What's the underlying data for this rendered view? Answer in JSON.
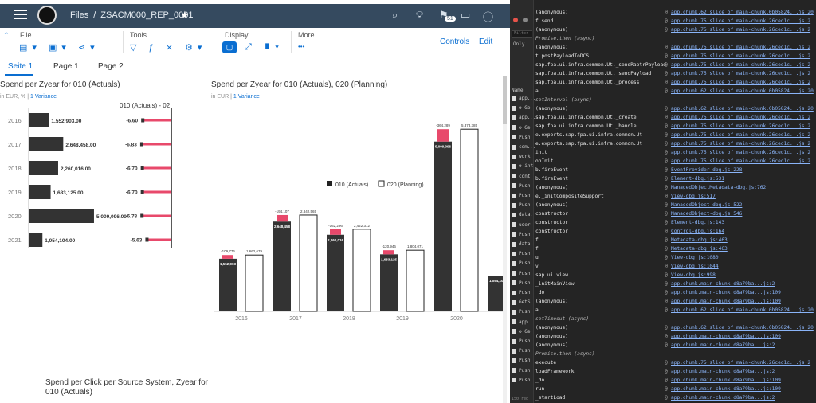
{
  "shell": {
    "breadcrumb_root": "Files",
    "breadcrumb_sep": "/",
    "story_title": "ZSACM000_REP_0001",
    "notifications_count": "51"
  },
  "toolbar": {
    "file_label": "File",
    "tools_label": "Tools",
    "display_label": "Display",
    "more_label": "More",
    "more_dots": "•••",
    "controls_label": "Controls",
    "edit_label": "Edit"
  },
  "tabs": [
    "Seite 1",
    "Page 1",
    "Page 2"
  ],
  "widgets": {
    "chart1": {
      "title": "Spend per Zyear for 010 (Actuals)",
      "unit": "in EUR, %",
      "variance": "1 Variance",
      "variance_header": "010 (Actuals) - 02"
    },
    "chart2": {
      "title": "Spend per Zyear for 010 (Actuals), 020 (Planning)",
      "unit": "in EUR",
      "variance": "1 Variance"
    },
    "chart3": {
      "title_line1": "Spend per Click per Source System, Zyear for",
      "title_line2": "010 (Actuals)"
    }
  },
  "chart_data": [
    {
      "type": "bar",
      "orientation": "horizontal",
      "title": "Spend per Zyear for 010 (Actuals)",
      "categories": [
        "2016",
        "2017",
        "2018",
        "2019",
        "2020",
        "2021"
      ],
      "series": [
        {
          "name": "010 (Actuals)",
          "values": [
            1552903,
            2648458,
            2260016,
            1683125,
            5009096,
            1054104
          ],
          "labels": [
            "1,552,903.00",
            "2,648,458.00",
            "2,260,016.00",
            "1,683,125.00",
            "5,009,096.00",
            "1,054,104.00"
          ]
        },
        {
          "name": "010 (Actuals) - 02",
          "values": [
            -6.6,
            -6.83,
            -6.7,
            -6.7,
            -6.78,
            -5.63
          ],
          "labels": [
            "-6.60",
            "-6.83",
            "-6.70",
            "-6.70",
            "-6.78",
            "-5.63"
          ]
        }
      ]
    },
    {
      "type": "bar",
      "title": "Spend per Zyear for 010 (Actuals), 020 (Planning)",
      "categories": [
        "2016",
        "2017",
        "2018",
        "2019",
        "2020",
        "2021"
      ],
      "legend": [
        "010 (Actuals)",
        "020 (Planning)"
      ],
      "series": [
        {
          "name": "010 (Actuals)",
          "values": [
            1552903,
            2648458,
            2260016,
            1683125,
            5009096,
            1054104
          ],
          "labels": [
            "1,552,903",
            "2,648,458",
            "2,260,016",
            "1,683,125",
            "5,009,096",
            "1,054,10"
          ]
        },
        {
          "name": "020 (Planning)",
          "values": [
            1662679,
            2842565,
            2422312,
            1804071,
            5373385,
            null
          ],
          "labels": [
            "1,662,679",
            "2,842,565",
            "2,422,312",
            "1,804,071",
            "5,373,385",
            ""
          ]
        },
        {
          "name": "variance",
          "values": [
            -109776,
            -194107,
            -162296,
            -120946,
            -364289,
            -62
          ],
          "labels": [
            "-109,776",
            "-194,107",
            "-162,296",
            "-120,946",
            "-364,289",
            "-62,8"
          ]
        }
      ],
      "visible_categories": [
        "2016",
        "2017",
        "2018",
        "2019",
        "2020"
      ]
    }
  ],
  "colors": {
    "shell": "#354a5f",
    "accent": "#0a6ed1",
    "bar": "#333333",
    "variance": "#e8496b"
  },
  "devtools": {
    "filter_placeholder": "Filter",
    "only_label": "Only",
    "name_header": "Name",
    "request_count": "150 req",
    "network_names": [
      "app...",
      "⚙ Ge",
      "app...",
      "⚙ Ge",
      "Push",
      "com...",
      "work",
      "⚙ int",
      "cont",
      "Push",
      "Push",
      "Push",
      "data.",
      "user",
      "Push",
      "data.",
      "Push",
      "Push",
      "Push",
      "Push",
      "Push",
      "GetS",
      "Push",
      "app...",
      "⚙ Ge",
      "Push",
      "Push",
      "Push",
      "Push",
      "Push"
    ],
    "stack": [
      {
        "fn": "(anonymous)",
        "loc": "app.chunk.62.slice of main-chunk.0b05824...js:20"
      },
      {
        "fn": "f.send",
        "loc": "app.chunk.75.slice of main-chunk.26ced1c...js:2"
      },
      {
        "fn": "(anonymous)",
        "loc": "app.chunk.75.slice of main-chunk.26ced1c...js:2"
      },
      {
        "fn": "Promise.then (async)",
        "loc": "",
        "async": true
      },
      {
        "fn": "(anonymous)",
        "loc": "app.chunk.75.slice of main-chunk.26ced1c...js:2"
      },
      {
        "fn": "t.postPayloadToDCS",
        "loc": "app.chunk.75.slice of main-chunk.26ced1c...js:2"
      },
      {
        "fn": "sap.fpa.ui.infra.common.Ut._sendRaptrPayload",
        "loc": "app.chunk.75.slice of main-chunk.26ced1c...js:2"
      },
      {
        "fn": "sap.fpa.ui.infra.common.Ut._sendPayload",
        "loc": "app.chunk.75.slice of main-chunk.26ced1c...js:2"
      },
      {
        "fn": "sap.fpa.ui.infra.common.Ut._process",
        "loc": "app.chunk.75.slice of main-chunk.26ced1c...js:2"
      },
      {
        "fn": "a",
        "loc": "app.chunk.62.slice of main-chunk.0b05824...js:20"
      },
      {
        "fn": "setInterval (async)",
        "loc": "",
        "async": true
      },
      {
        "fn": "(anonymous)",
        "loc": "app.chunk.62.slice of main-chunk.0b05824...js:20"
      },
      {
        "fn": "sap.fpa.ui.infra.common.Ut._create",
        "loc": "app.chunk.75.slice of main-chunk.26ced1c...js:2"
      },
      {
        "fn": "sap.fpa.ui.infra.common.Ut._handle",
        "loc": "app.chunk.75.slice of main-chunk.26ced1c...js:2"
      },
      {
        "fn": "e.exports.sap.fpa.ui.infra.common.Ut",
        "loc": "app.chunk.75.slice of main-chunk.26ced1c...js:2"
      },
      {
        "fn": "e.exports.sap.fpa.ui.infra.common.Ut",
        "loc": "app.chunk.75.slice of main-chunk.26ced1c...js:2"
      },
      {
        "fn": "init",
        "loc": "app.chunk.75.slice of main-chunk.26ced1c...js:2"
      },
      {
        "fn": "onInit",
        "loc": "app.chunk.75.slice of main-chunk.26ced1c...js:2"
      },
      {
        "fn": "b.fireEvent",
        "loc": "EventProvider-dbg.js:228"
      },
      {
        "fn": "b.fireEvent",
        "loc": "Element-dbg.js:531"
      },
      {
        "fn": "(anonymous)",
        "loc": "ManagedObjectMetadata-dbg.js:762"
      },
      {
        "fn": "e._initCompositeSupport",
        "loc": "View-dbg.js:517"
      },
      {
        "fn": "(anonymous)",
        "loc": "ManagedObject-dbg.js:522"
      },
      {
        "fn": "constructor",
        "loc": "ManagedObject-dbg.js:546"
      },
      {
        "fn": "constructor",
        "loc": "Element-dbg.js:143"
      },
      {
        "fn": "constructor",
        "loc": "Control-dbg.js:164"
      },
      {
        "fn": "f",
        "loc": "Metadata-dbg.js:463"
      },
      {
        "fn": "f",
        "loc": "Metadata-dbg.js:463"
      },
      {
        "fn": "u",
        "loc": "View-dbg.js:1080"
      },
      {
        "fn": "v",
        "loc": "View-dbg.js:1044"
      },
      {
        "fn": "sap.ui.view",
        "loc": "View-dbg.js:998"
      },
      {
        "fn": "_initMainView",
        "loc": "app.chunk.main-chunk.d8a79ba...js:2"
      },
      {
        "fn": "_do",
        "loc": "app.chunk.main-chunk.d8a79ba...js:109"
      },
      {
        "fn": "(anonymous)",
        "loc": "app.chunk.main-chunk.d8a79ba...js:109"
      },
      {
        "fn": "a",
        "loc": "app.chunk.62.slice of main-chunk.0b05824...js:20"
      },
      {
        "fn": "setTimeout (async)",
        "loc": "",
        "async": true
      },
      {
        "fn": "(anonymous)",
        "loc": "app.chunk.62.slice of main-chunk.0b05824...js:20"
      },
      {
        "fn": "(anonymous)",
        "loc": "app.chunk.main-chunk.d8a79ba...js:109"
      },
      {
        "fn": "(anonymous)",
        "loc": "app.chunk.main-chunk.d8a79ba...js:2"
      },
      {
        "fn": "Promise.then (async)",
        "loc": "",
        "async": true
      },
      {
        "fn": "execute",
        "loc": "app.chunk.75.slice of main-chunk.26ced1c...js:2"
      },
      {
        "fn": "loadFramework",
        "loc": "app.chunk.main-chunk.d8a79ba...js:2"
      },
      {
        "fn": "_do",
        "loc": "app.chunk.main-chunk.d8a79ba...js:109"
      },
      {
        "fn": "run",
        "loc": "app.chunk.main-chunk.d8a79ba...js:109"
      },
      {
        "fn": "_startLoad",
        "loc": "app.chunk.main-chunk.d8a79ba...js:2"
      }
    ]
  }
}
